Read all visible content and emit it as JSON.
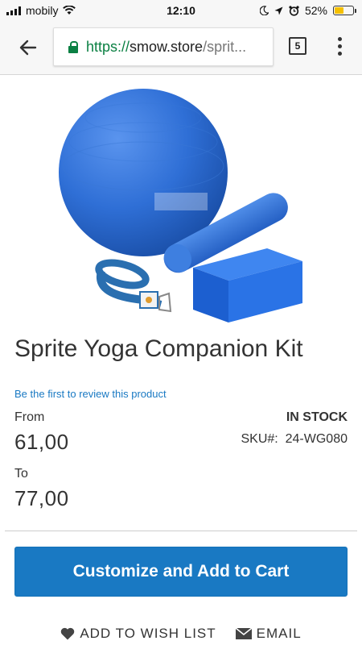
{
  "status_bar": {
    "carrier": "mobily",
    "time": "12:10",
    "battery_percent": "52%",
    "battery_level": 0.52,
    "icons": [
      "signal-icon",
      "wifi-icon",
      "moon-icon",
      "location-arrow-icon",
      "alarm-icon",
      "battery-icon"
    ]
  },
  "browser": {
    "url_scheme": "https://",
    "url_host": "smow.store",
    "url_path": "/sprit...",
    "tab_count": "5",
    "icons": [
      "back-arrow-icon",
      "lock-icon",
      "tabs-icon",
      "more-vert-icon"
    ]
  },
  "product": {
    "title": "Sprite Yoga Companion Kit",
    "review_link": "Be the first to review this product",
    "from_label": "From",
    "from_price": "61,00",
    "to_label": "To",
    "to_price": "77,00",
    "stock": "In stock",
    "sku_label": "SKU#:",
    "sku_value": "24-WG080"
  },
  "actions": {
    "add_to_cart": "Customize and Add to Cart",
    "wishlist": "Add to Wish List",
    "email": "Email"
  },
  "colors": {
    "accent": "#1979c3",
    "secure_green": "#0b8043",
    "ball_blue": "#2f6fd6",
    "battery": "#f5c000"
  }
}
